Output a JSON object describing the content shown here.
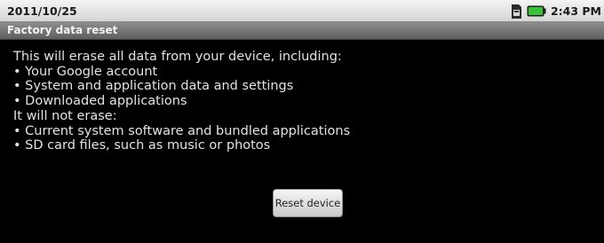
{
  "status_bar": {
    "date": "2011/10/25",
    "time": "2:43 PM",
    "icons": [
      "sim-card-icon",
      "battery-icon"
    ],
    "battery_color": "#38c238"
  },
  "title_bar": {
    "title": "Factory data reset"
  },
  "message": {
    "lines": [
      "This will erase all data from your device, including:",
      "• Your Google account",
      "• System and application data and settings",
      "• Downloaded applications",
      "It will not erase:",
      "• Current system software and bundled applications",
      "• SD card files, such as music or photos"
    ]
  },
  "reset_button": {
    "label": "Reset device"
  }
}
